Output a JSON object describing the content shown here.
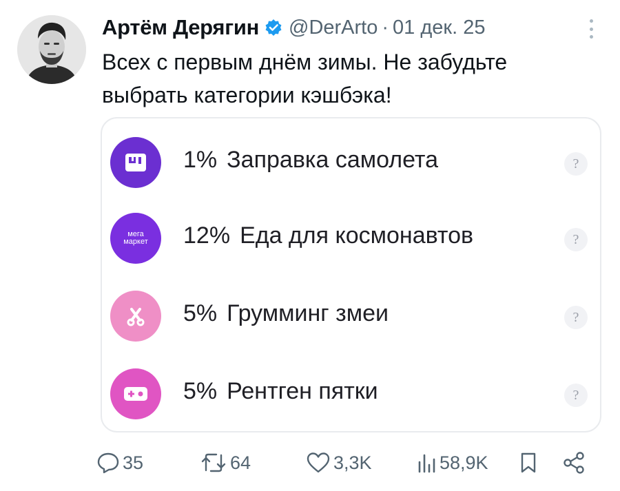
{
  "post": {
    "author_name": "Артём Дерягин",
    "handle": "@DerArto",
    "separator": "·",
    "date": "01 дек. 25",
    "text": "Всех с первым днём зимы. Не забудьте выбрать категории кэшбэка!"
  },
  "cashback_card": {
    "categories": [
      {
        "percent": "1%",
        "name": "Заправка самолета",
        "icon": "bag-icon",
        "help": "?",
        "color": "#6b2fd1"
      },
      {
        "percent": "12%",
        "name": "Еда для космонавтов",
        "icon": "megamarket-logo",
        "icon_text_1": "мега",
        "icon_text_2": "маркет",
        "help": "?",
        "color": "#7a2fe0"
      },
      {
        "percent": "5%",
        "name": "Грумминг змеи",
        "icon": "scissors-icon",
        "help": "?",
        "color": "#ef8fc6"
      },
      {
        "percent": "5%",
        "name": "Рентген пятки",
        "icon": "gamepad-icon",
        "help": "?",
        "color": "#e055c3"
      }
    ]
  },
  "actions": {
    "replies": "35",
    "reposts": "64",
    "likes": "3,3K",
    "views": "58,9K"
  },
  "colors": {
    "verified_badge": "#1d9bf0",
    "muted_text": "#536471"
  }
}
